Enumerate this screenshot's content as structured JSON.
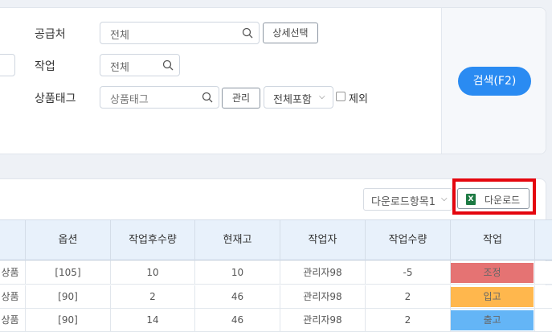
{
  "filters": {
    "supplier": {
      "label": "공급처",
      "value": "전체",
      "detail_button": "상세선택"
    },
    "task": {
      "label": "작업",
      "value": "전체"
    },
    "product_tag": {
      "label": "상품태그",
      "placeholder": "상품태그",
      "manage_button": "관리",
      "scope_select": "전체포함",
      "exclude_label": "제외"
    },
    "search_button": "검색(F2)"
  },
  "download": {
    "item_select": "다운로드항목1",
    "button_label": "다운로드",
    "excel_icon_letter": "X"
  },
  "table": {
    "columns": [
      "옵션",
      "작업후수량",
      "현재고",
      "작업자",
      "작업수량",
      "작업"
    ],
    "rows": [
      {
        "product_fragment": "상품",
        "option": "[105]",
        "after_qty": "10",
        "stock": "10",
        "worker": "관리자98",
        "qty": "-5",
        "action": "조정",
        "action_color": "#e57373"
      },
      {
        "product_fragment": "상품",
        "option": "[90]",
        "after_qty": "2",
        "stock": "46",
        "worker": "관리자98",
        "qty": "2",
        "action": "입고",
        "action_color": "#ffb74d"
      },
      {
        "product_fragment": "상품",
        "option": "[90]",
        "after_qty": "14",
        "stock": "46",
        "worker": "관리자98",
        "qty": "2",
        "action": "출고",
        "action_color": "#64b5f6"
      }
    ]
  }
}
